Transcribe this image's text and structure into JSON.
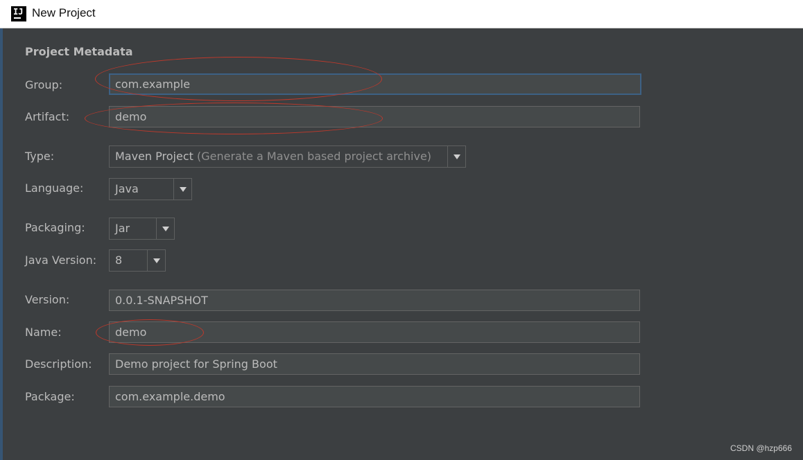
{
  "window": {
    "title": "New Project",
    "app_icon": "intellij-idea-icon"
  },
  "section": {
    "title": "Project Metadata"
  },
  "fields": {
    "group": {
      "label": "Group:",
      "value": "com.example"
    },
    "artifact": {
      "label": "Artifact:",
      "value": "demo"
    },
    "type": {
      "label": "Type:",
      "value": "Maven Project",
      "hint": "(Generate a Maven based project archive)"
    },
    "language": {
      "label": "Language:",
      "value": "Java"
    },
    "packaging": {
      "label": "Packaging:",
      "value": "Jar"
    },
    "java_version": {
      "label": "Java Version:",
      "value": "8"
    },
    "version": {
      "label": "Version:",
      "value": "0.0.1-SNAPSHOT"
    },
    "name": {
      "label": "Name:",
      "value": "demo"
    },
    "description": {
      "label": "Description:",
      "value": "Demo project for Spring Boot"
    },
    "package": {
      "label": "Package:",
      "value": "com.example.demo"
    }
  },
  "watermark": "CSDN @hzp666",
  "colors": {
    "background": "#3c3f41",
    "field_bg": "#45494a",
    "focus_border": "#3d6185",
    "annotation": "#c0392b"
  }
}
